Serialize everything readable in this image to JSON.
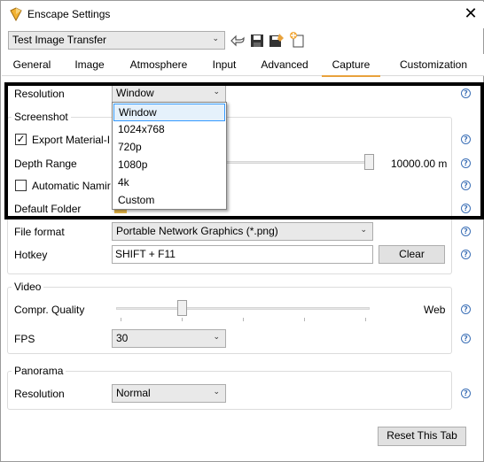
{
  "window": {
    "title": "Enscape Settings",
    "close_glyph": "✕"
  },
  "preset": {
    "value": "Test Image Transfer",
    "arrow": "⌄"
  },
  "toolbar_icons": [
    "undo-icon",
    "save-icon",
    "save-as-icon",
    "new-preset-icon"
  ],
  "tabs": [
    {
      "label": "General"
    },
    {
      "label": "Image"
    },
    {
      "label": "Atmosphere"
    },
    {
      "label": "Input"
    },
    {
      "label": "Advanced"
    },
    {
      "label": "Capture"
    },
    {
      "label": "Customization"
    }
  ],
  "active_tab": "Capture",
  "resolution": {
    "label": "Resolution",
    "value": "Window",
    "options": [
      "Window",
      "1024x768",
      "720p",
      "1080p",
      "4k",
      "Custom"
    ]
  },
  "screenshot": {
    "title": "Screenshot",
    "export_material_label": "Export Material-I",
    "export_material_checked": true,
    "depth_range_label": "Depth Range",
    "depth_range_value": "10000.00 m",
    "depth_range_fraction": 1.0,
    "automatic_naming_label": "Automatic Namir",
    "automatic_naming_checked": false,
    "default_folder_label": "Default Folder",
    "file_format_label": "File format",
    "file_format_value": "Portable Network Graphics (*.png)",
    "hotkey_label": "Hotkey",
    "hotkey_value": "SHIFT + F11",
    "clear_label": "Clear"
  },
  "video": {
    "title": "Video",
    "compr_quality_label": "Compr. Quality",
    "compr_quality_value": "Web",
    "compr_quality_fraction": 0.25,
    "fps_label": "FPS",
    "fps_value": "30"
  },
  "panorama": {
    "title": "Panorama",
    "resolution_label": "Resolution",
    "resolution_value": "Normal"
  },
  "reset_label": "Reset This Tab",
  "help_glyph": "?",
  "colors": {
    "accent_tab": "#e8a23c",
    "help_blue": "#3b6fb6",
    "selection_blue": "#3399ff"
  }
}
